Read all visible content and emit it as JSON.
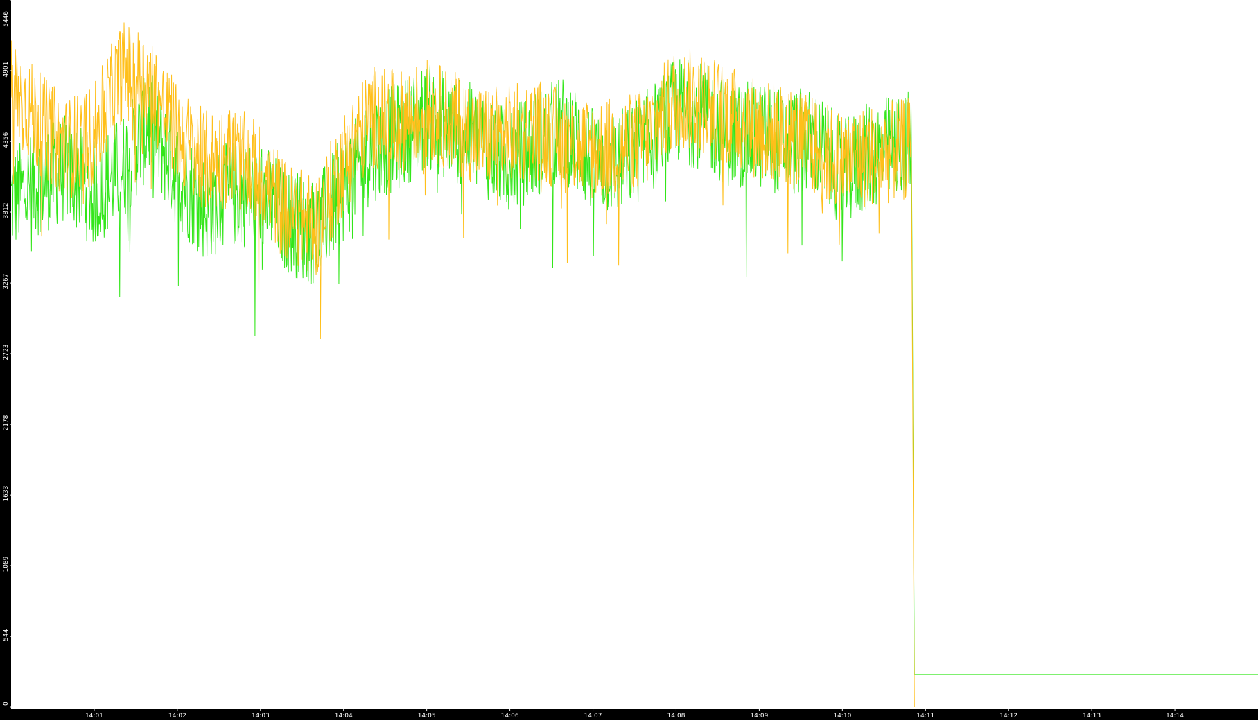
{
  "chart_data": {
    "type": "line",
    "title": "",
    "xlabel": "",
    "ylabel": "",
    "grid": false,
    "legend": "none",
    "background": "#ffffff",
    "axis_band_color": "#000000",
    "axis_text_color": "#ffffff",
    "x_range": [
      "14:00:00",
      "14:15:00"
    ],
    "x_ticks": [
      "14:01",
      "14:02",
      "14:03",
      "14:04",
      "14:05",
      "14:06",
      "14:07",
      "14:08",
      "14:09",
      "14:10",
      "14:11",
      "14:12",
      "14:13",
      "14:14"
    ],
    "y_range": [
      0,
      5446
    ],
    "y_ticks": [
      "0",
      "544",
      "1089",
      "1633",
      "2178",
      "2723",
      "3267",
      "3812",
      "4356",
      "4901",
      "5446"
    ],
    "series": [
      {
        "color": "#33e61a",
        "x": [
          "14:00:00",
          "14:00:20",
          "14:00:40",
          "14:01:00",
          "14:01:20",
          "14:01:40",
          "14:02:00",
          "14:02:20",
          "14:02:40",
          "14:03:00",
          "14:03:20",
          "14:03:40",
          "14:04:00",
          "14:04:20",
          "14:04:40",
          "14:05:00",
          "14:05:20",
          "14:05:40",
          "14:06:00",
          "14:06:20",
          "14:06:40",
          "14:07:00",
          "14:07:20",
          "14:07:40",
          "14:08:00",
          "14:08:20",
          "14:08:40",
          "14:09:00",
          "14:09:20",
          "14:09:40",
          "14:10:00",
          "14:10:20",
          "14:10:50",
          "14:10:52",
          "14:11:00",
          "14:12:00",
          "14:13:00",
          "14:14:00",
          "14:15:00"
        ],
        "y": [
          3900,
          4050,
          4150,
          3950,
          4150,
          4500,
          4100,
          3850,
          3950,
          3950,
          3750,
          3650,
          4000,
          4300,
          4400,
          4550,
          4450,
          4350,
          4200,
          4350,
          4450,
          4200,
          4200,
          4350,
          4600,
          4550,
          4400,
          4400,
          4350,
          4350,
          4100,
          4250,
          4350,
          250,
          250,
          250,
          250,
          250,
          250
        ],
        "noise": 420
      },
      {
        "color": "#ffbf1a",
        "x": [
          "14:00:00",
          "14:00:20",
          "14:00:40",
          "14:01:00",
          "14:01:20",
          "14:01:40",
          "14:02:00",
          "14:02:20",
          "14:02:40",
          "14:03:00",
          "14:03:20",
          "14:03:40",
          "14:04:00",
          "14:04:20",
          "14:04:40",
          "14:05:00",
          "14:05:20",
          "14:05:40",
          "14:06:00",
          "14:06:20",
          "14:06:40",
          "14:07:00",
          "14:07:20",
          "14:07:40",
          "14:08:00",
          "14:08:20",
          "14:08:40",
          "14:09:00",
          "14:09:20",
          "14:09:40",
          "14:10:00",
          "14:10:20",
          "14:10:50",
          "14:10:52"
        ],
        "y": [
          4800,
          4500,
          4300,
          4400,
          4900,
          4800,
          4400,
          4200,
          4250,
          4100,
          3800,
          3700,
          4200,
          4550,
          4500,
          4600,
          4500,
          4400,
          4400,
          4450,
          4350,
          4300,
          4300,
          4400,
          4700,
          4650,
          4550,
          4450,
          4400,
          4300,
          4200,
          4250,
          4300,
          0
        ],
        "noise": 400
      }
    ]
  }
}
